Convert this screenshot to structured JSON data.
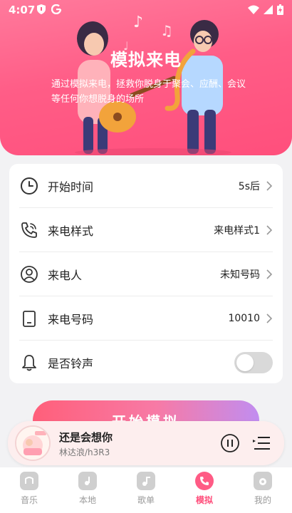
{
  "status_bar": {
    "time": "4:07",
    "left_icons": [
      "shield-icon",
      "google-icon"
    ],
    "right_icons": [
      "wifi-icon",
      "signal-icon",
      "battery-icon"
    ]
  },
  "header": {
    "title": "模拟来电",
    "description": "通过模拟来电，拯救你脱身于聚会、应酬、会议等任何你想脱身的场所",
    "background_color": "#ff5d87"
  },
  "settings": [
    {
      "icon": "clock-icon",
      "label": "开始时间",
      "value": "5s后"
    },
    {
      "icon": "phone-call-icon",
      "label": "来电样式",
      "value": "来电样式1"
    },
    {
      "icon": "user-icon",
      "label": "来电人",
      "value": "未知号码"
    },
    {
      "icon": "tablet-icon",
      "label": "来电号码",
      "value": "10010"
    },
    {
      "icon": "bell-icon",
      "label": "是否铃声",
      "toggle": false
    }
  ],
  "start_button": {
    "label": "开始模拟"
  },
  "player": {
    "title": "还是会想你",
    "artist": "林达浪/h3R3",
    "controls": [
      "pause-icon",
      "playlist-icon"
    ]
  },
  "nav": {
    "items": [
      {
        "label": "音乐",
        "icon": "music-icon",
        "active": false
      },
      {
        "label": "本地",
        "icon": "folder-music-icon",
        "active": false
      },
      {
        "label": "歌单",
        "icon": "playlist-note-icon",
        "active": false
      },
      {
        "label": "模拟",
        "icon": "phone-icon",
        "active": true
      },
      {
        "label": "我的",
        "icon": "profile-icon",
        "active": false
      }
    ],
    "active_color": "#ff4f7c"
  }
}
